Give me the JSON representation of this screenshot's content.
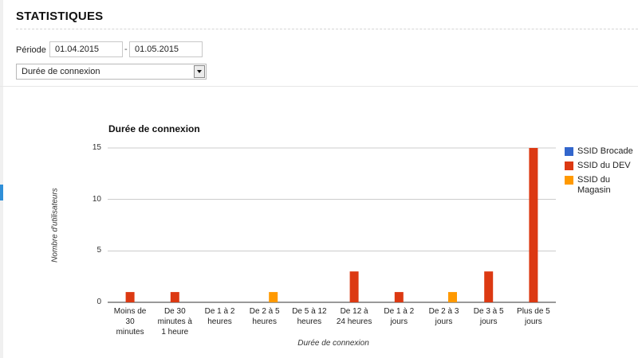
{
  "page": {
    "title": "STATISTIQUES"
  },
  "period": {
    "label": "Période :",
    "start": "01.04.2015",
    "separator": "-",
    "end": "01.05.2015"
  },
  "report_select": {
    "value": "Durée de connexion"
  },
  "colors": {
    "accent": "#2f8fd8"
  },
  "chart_data": {
    "type": "bar",
    "title": "Durée de connexion",
    "xlabel": "Durée de connexion",
    "ylabel": "Nombre d'utilisateurs",
    "ylim": [
      0,
      15
    ],
    "yticks": [
      0,
      5,
      10,
      15
    ],
    "grid": true,
    "legend_position": "right",
    "categories": [
      [
        "Moins de",
        "30",
        "minutes"
      ],
      [
        "De 30",
        "minutes à",
        "1 heure"
      ],
      [
        "De 1 à 2",
        "heures"
      ],
      [
        "De 2 à 5",
        "heures"
      ],
      [
        "De 5 à 12",
        "heures"
      ],
      [
        "De 12 à",
        "24 heures"
      ],
      [
        "De 1 à 2",
        "jours"
      ],
      [
        "De 2 à 3",
        "jours"
      ],
      [
        "De 3 à 5",
        "jours"
      ],
      [
        "Plus de 5",
        "jours"
      ]
    ],
    "series": [
      {
        "name": "SSID Brocade",
        "legend_lines": [
          "SSID Brocade"
        ],
        "color": "#3366cc",
        "values": [
          0,
          0,
          0,
          0,
          0,
          0,
          0,
          0,
          0,
          0
        ]
      },
      {
        "name": "SSID du DEV",
        "legend_lines": [
          "SSID du DEV"
        ],
        "color": "#dc3912",
        "values": [
          1,
          1,
          0,
          0,
          0,
          3,
          1,
          0,
          3,
          15
        ]
      },
      {
        "name": "SSID du Magasin",
        "legend_lines": [
          "SSID du",
          "Magasin"
        ],
        "color": "#ff9900",
        "values": [
          0,
          0,
          0,
          1,
          0,
          0,
          0,
          1,
          0,
          0
        ]
      }
    ]
  }
}
